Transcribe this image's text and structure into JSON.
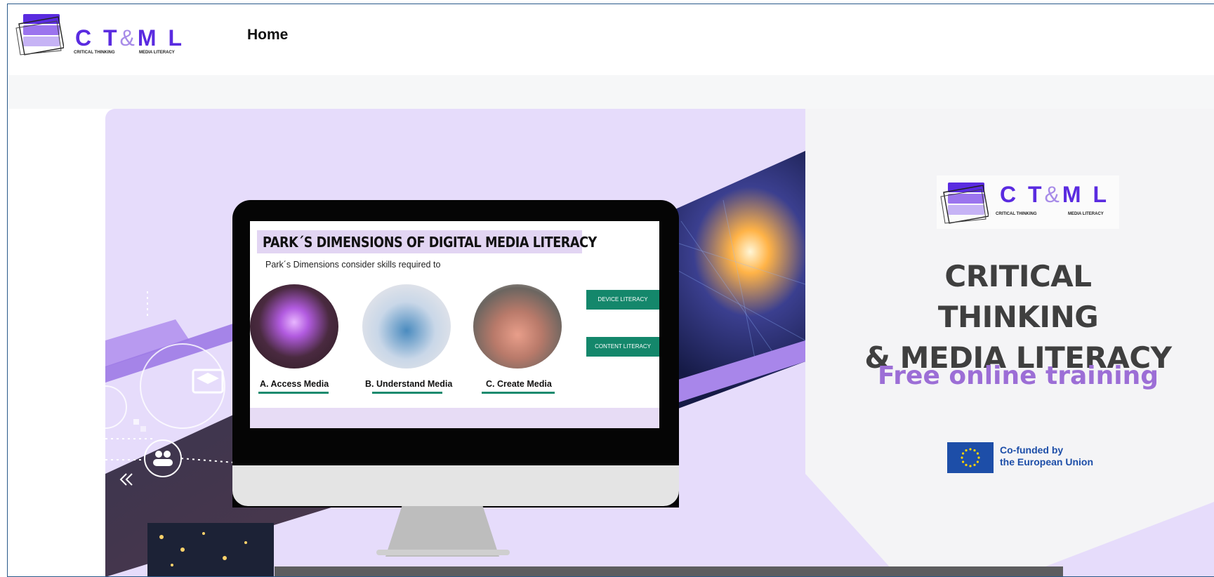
{
  "header": {
    "logo": {
      "wordmark": "C T&M L",
      "left_word": "C T",
      "amp": "&",
      "right_word": "M L",
      "sub_left": "CRITICAL THINKING",
      "sub_right": "MEDIA LITERACY"
    },
    "nav": {
      "home_label": "Home"
    }
  },
  "hero": {
    "slide": {
      "title": "PARK´S DIMENSIONS OF DIGITAL MEDIA LITERACY",
      "subtitle": "Park´s Dimensions consider skills required to",
      "items": [
        {
          "label": "A. Access Media"
        },
        {
          "label": "B. Understand Media"
        },
        {
          "label": "C. Create Media"
        }
      ],
      "tags": [
        "DEVICE LITERACY",
        "CONTENT LITERACY"
      ]
    },
    "right": {
      "logo": {
        "left_word": "C T",
        "amp": "&",
        "right_word": "M L",
        "sub_left": "CRITICAL THINKING",
        "sub_right": "MEDIA LITERACY"
      },
      "headline_line1": "CRITICAL THINKING",
      "headline_line2": "& MEDIA LITERACY",
      "tagline": "Free online training",
      "eu_line1": "Co-funded by",
      "eu_line2": "the European Union"
    }
  },
  "colors": {
    "brand_purple": "#5a2be0",
    "lavender": "#e6dcfb",
    "tagline": "#9c6ed6",
    "eu_blue": "#1d4ea8",
    "slide_green": "#14876b"
  },
  "icons": [
    "logo-stack-icon",
    "eu-flag-icon",
    "graduation-cap-icon",
    "user-group-icon",
    "play-icon",
    "double-chevron-left-icon"
  ]
}
